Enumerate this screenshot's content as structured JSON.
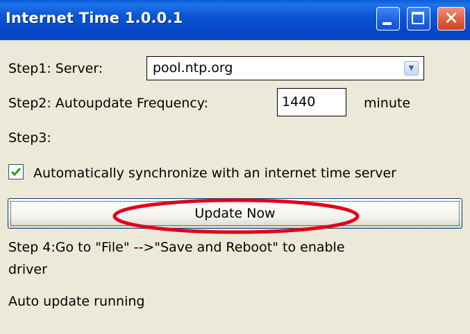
{
  "window": {
    "title": "Internet Time 1.0.0.1",
    "controls": [
      "minimize",
      "maximize",
      "close"
    ]
  },
  "step1": {
    "label": "Step1: Server:",
    "server_value": "pool.ntp.org"
  },
  "step2": {
    "label": "Step2: Autoupdate Frequency:",
    "frequency_value": "1440",
    "unit": "minute"
  },
  "step3": {
    "label": "Step3:",
    "auto_sync_label": "Automatically synchronize with an internet time server",
    "auto_sync_checked": true
  },
  "update_button": {
    "label": "Update Now"
  },
  "step4": {
    "line1": "Step 4:Go to \"File\" -->\"Save and Reboot\" to enable",
    "line2": "driver"
  },
  "status": {
    "text": "Auto update running"
  },
  "colors": {
    "titlebar": "#0b55d3",
    "window_bg": "#ece9d8",
    "annotation_red": "#e0001b",
    "checkmark": "#21a121"
  },
  "icons": {
    "minimize": "minimize-icon",
    "maximize": "maximize-icon",
    "close": "close-icon",
    "dropdown": "chevron-down-icon",
    "check": "checkmark-icon"
  }
}
